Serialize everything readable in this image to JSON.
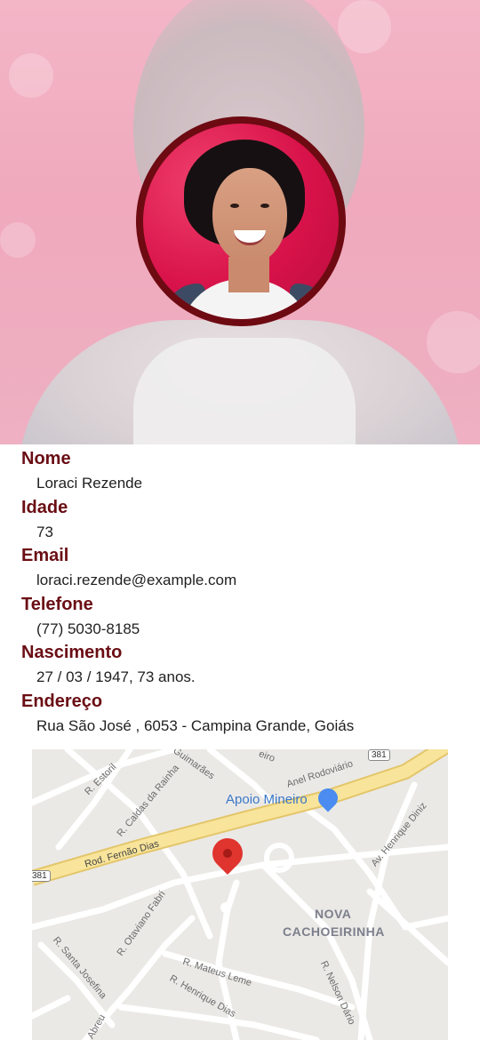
{
  "profile": {
    "labels": {
      "nome": "Nome",
      "idade": "Idade",
      "email": "Email",
      "telefone": "Telefone",
      "nascimento": "Nascimento",
      "endereco": "Endereço"
    },
    "values": {
      "nome": "Loraci Rezende",
      "idade": "73",
      "email": "loraci.rezende@example.com",
      "telefone": "(77) 5030-8185",
      "nascimento": "27 / 03 / 1947,  73 anos.",
      "endereco": "Rua São José , 6053 - Campina Grande, Goiás"
    }
  },
  "map": {
    "streets": {
      "estoril": "R. Estoril",
      "caldas": "R. Caldas da Rainha",
      "guimaraes": "Guimarães",
      "anel": "Anel Rodoviário",
      "fernao": "Rod. Fernão Dias",
      "henrique_diniz": "Av. Henrique Diniz",
      "otaviano": "R. Otaviano Fabri",
      "santa_josefina": "R. Santa Josefina",
      "mateus_leme": "R. Mateus Leme",
      "henrique_dias": "R. Henrique Dias",
      "nelson_dario": "R. Nelson Dário",
      "abreu": "Abreu",
      "pedro": "eiro"
    },
    "poi": "Apoio Mineiro",
    "district_line1": "NOVA",
    "district_line2": "CACHOEIRINHA",
    "route_top": "381",
    "route_left": "381"
  },
  "colors": {
    "label": "#6a0e14",
    "avatar_ring": "#6e0a12",
    "highway": "#f8e49a",
    "pin": "#e0342e"
  }
}
